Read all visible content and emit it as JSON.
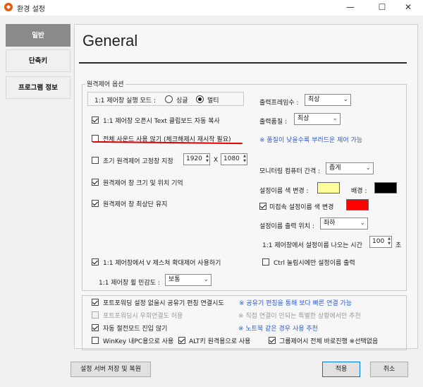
{
  "window": {
    "title": "환경 설정",
    "minimize": "—",
    "maximize": "☐",
    "close": "✕"
  },
  "sidebar": {
    "items": [
      {
        "label": "일반",
        "active": true
      },
      {
        "label": "단축키",
        "active": false
      },
      {
        "label": "프로그램 정보",
        "active": false
      }
    ]
  },
  "page": {
    "title": "General"
  },
  "remote": {
    "legend": "원격제어 옵션",
    "run_mode_label": "1:1 제어창 실행 모드 :",
    "run_mode_options": [
      "싱글",
      "멀티"
    ],
    "run_mode_selected": "멀티",
    "clipboard_copy": "1:1 제어창 오픈시 Text 클립보드 자동 복사",
    "disable_sound": "전체 사운드 사용 않기 (체크해제시 재시작 필요)",
    "fixed_window": "초기 원격제어 고정창 지정",
    "fixed_w": "1920",
    "fixed_x": "X",
    "fixed_h": "1080",
    "remember_size": "원격제어 창 크기 및 위치 기억",
    "keep_on_top": "원격제어 창 최상단 유지",
    "zoom_gesture": "1:1 제어창에서 V 제스쳐 확대제어 사용하기",
    "wheel_sensitivity_label": "1:1 제어창 휠 민감도 :",
    "wheel_sensitivity_value": "보통",
    "output_frames_label": "출력프레임수 :",
    "output_frames_value": "최상",
    "output_quality_label": "출력품질 :",
    "output_quality_value": "최상",
    "quality_note": "※ 품질이 낮을수록 부러드운 제어 가능",
    "monitor_interval_label": "모니터링 컴퓨터 간격 :",
    "monitor_interval_value": "좁게",
    "name_color_label": "설정이름 색 변경 :",
    "bg_label": "배경 :",
    "name_color": "#ffff99",
    "bg_color": "#000000",
    "disconnected_color_label": "미접속 설정이름 색 변경",
    "disconnected_color": "#ff0000",
    "name_position_label": "설정이름 출력 위치 :",
    "name_position_value": "좌하",
    "display_time_label": "1:1 제어창에서 설정이름 나오는 시간",
    "display_time_value": "100",
    "display_time_unit": "초",
    "ctrl_name_label": "Ctrl 눌림시에만 설정이름 출력"
  },
  "bottom_options": {
    "port_forward_share": "포트포워딩 설정 없을시 공유기 편칭 연결시도",
    "port_forward_share_note": "※ 공유기 편칭을 통해 보다 빠른 연결 가능",
    "port_forward_bypass": "포트포워딩시 우회연결도 허용",
    "port_forward_bypass_note": "※ 직접 연결이 안되는 특별한 상황에서만 추천",
    "no_power_save": "자동 절전모드 진입 않기",
    "no_power_save_note": "※ 노트북 같은 경우 사용 추천",
    "winkey_local": "WinKey 내PC용으로 사용",
    "alt_remote": "ALT키 원격용으로 사용",
    "group_control": "그룹제어시 전체 바로진행 ※선택없음"
  },
  "buttons": {
    "save_server": "설정 서버 저장 및 복원",
    "apply": "적용",
    "cancel": "취소"
  },
  "colors": {
    "accent": "#0078d7",
    "note_blue": "#2f5bd8",
    "sidebar_active": "#8a8a8a",
    "annotation_red": "#e00000"
  }
}
